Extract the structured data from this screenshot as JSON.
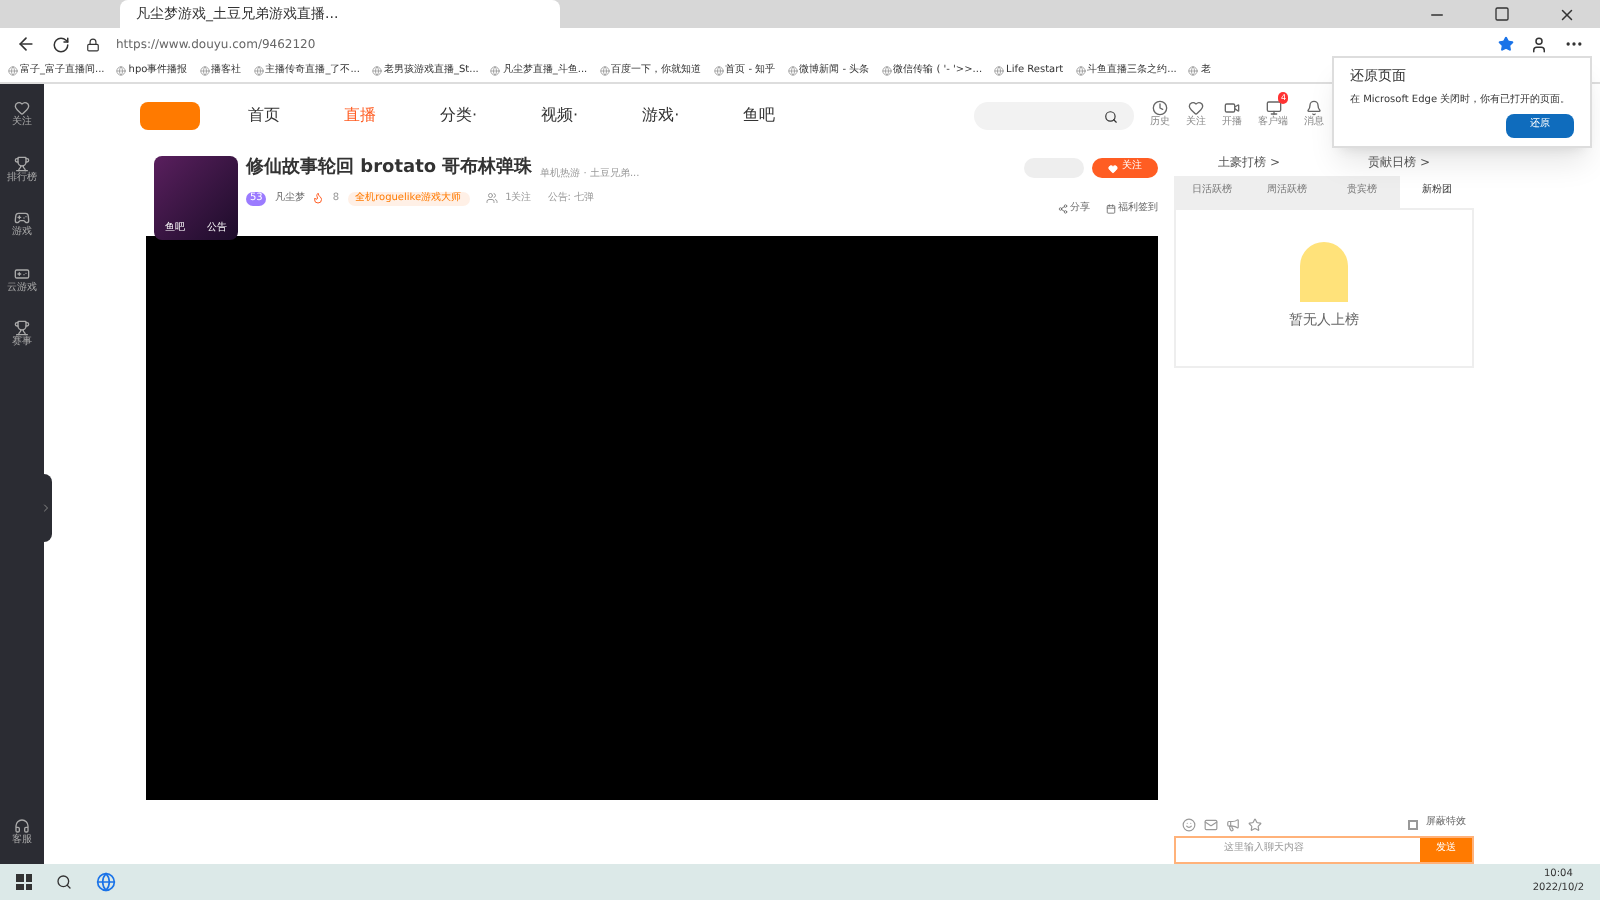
{
  "browser": {
    "tab_title": "凡尘梦游戏_土豆兄弟游戏直播...",
    "url": "https://www.douyu.com/9462120",
    "bookmarks": [
      "富子_富子直播间...",
      "hpo事件播报",
      "播客社",
      "主播传奇直播_了不...",
      "老男孩游戏直播_St...",
      "凡尘梦直播_斗鱼...",
      "百度一下，你就知道",
      "首页 - 知乎",
      "微博新闻 - 头条",
      "微信传输 ( '- '>>...",
      "Life Restart",
      "斗鱼直播三条之约...",
      "老"
    ]
  },
  "restore_popup": {
    "title": "还原页面",
    "message": "在 Microsoft Edge 关闭时，你有已打开的页面。",
    "button": "还原"
  },
  "nav": [
    {
      "label": "首页",
      "selected": false
    },
    {
      "label": "直播",
      "selected": true
    },
    {
      "label": "分类·",
      "selected": false
    },
    {
      "label": "视频·",
      "selected": false
    },
    {
      "label": "游戏·",
      "selected": false
    },
    {
      "label": "鱼吧",
      "selected": false
    }
  ],
  "header_actions": [
    {
      "label": "历史"
    },
    {
      "label": "关注"
    },
    {
      "label": "开播"
    },
    {
      "label": "客户端",
      "badge": "4"
    },
    {
      "label": "消息"
    }
  ],
  "sidebar": [
    "关注",
    "排行榜",
    "游戏",
    "云游戏",
    "赛事"
  ],
  "sidebar_bottom": "客服",
  "room": {
    "thumb_labels": [
      "鱼吧",
      "公告"
    ],
    "title": "修仙故事轮回 brotato 哥布林弹珠",
    "category": "单机热游 · 土豆兄弟...",
    "level": "53",
    "streamer": "凡尘梦",
    "heat": "8",
    "tag": "全机roguelike游戏大师",
    "followers": "1关注",
    "notice": "公告: 七弹",
    "follow": "关注",
    "share": "分享",
    "signin": "福利签到"
  },
  "rank": {
    "links": [
      "土豪打榜 >",
      "贡献日榜 >"
    ],
    "tabs": [
      {
        "label": "日活跃榜",
        "selected": false
      },
      {
        "label": "周活跃榜",
        "selected": false
      },
      {
        "label": "贵宾榜",
        "selected": false
      },
      {
        "label": "新粉团",
        "selected": true
      }
    ],
    "empty": "暂无人上榜"
  },
  "chat": {
    "block_effects": {
      "label": "屏蔽特效",
      "checked": false
    },
    "placeholder": "这里输入聊天内容",
    "send": "发送"
  },
  "taskbar": {
    "time": "10:04",
    "date": "2022/10/2"
  }
}
